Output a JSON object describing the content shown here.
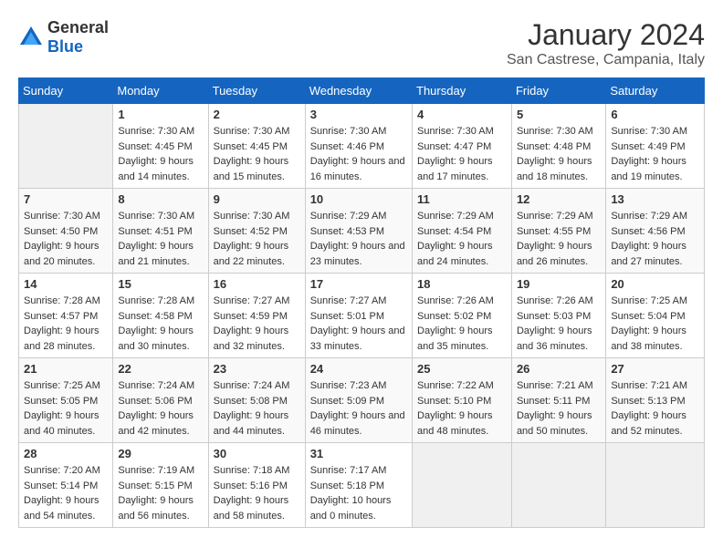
{
  "logo": {
    "general": "General",
    "blue": "Blue"
  },
  "header": {
    "title": "January 2024",
    "subtitle": "San Castrese, Campania, Italy"
  },
  "columns": [
    "Sunday",
    "Monday",
    "Tuesday",
    "Wednesday",
    "Thursday",
    "Friday",
    "Saturday"
  ],
  "weeks": [
    [
      {
        "day": "",
        "sunrise": "",
        "sunset": "",
        "daylight": ""
      },
      {
        "day": "1",
        "sunrise": "Sunrise: 7:30 AM",
        "sunset": "Sunset: 4:45 PM",
        "daylight": "Daylight: 9 hours and 14 minutes."
      },
      {
        "day": "2",
        "sunrise": "Sunrise: 7:30 AM",
        "sunset": "Sunset: 4:45 PM",
        "daylight": "Daylight: 9 hours and 15 minutes."
      },
      {
        "day": "3",
        "sunrise": "Sunrise: 7:30 AM",
        "sunset": "Sunset: 4:46 PM",
        "daylight": "Daylight: 9 hours and 16 minutes."
      },
      {
        "day": "4",
        "sunrise": "Sunrise: 7:30 AM",
        "sunset": "Sunset: 4:47 PM",
        "daylight": "Daylight: 9 hours and 17 minutes."
      },
      {
        "day": "5",
        "sunrise": "Sunrise: 7:30 AM",
        "sunset": "Sunset: 4:48 PM",
        "daylight": "Daylight: 9 hours and 18 minutes."
      },
      {
        "day": "6",
        "sunrise": "Sunrise: 7:30 AM",
        "sunset": "Sunset: 4:49 PM",
        "daylight": "Daylight: 9 hours and 19 minutes."
      }
    ],
    [
      {
        "day": "7",
        "sunrise": "Sunrise: 7:30 AM",
        "sunset": "Sunset: 4:50 PM",
        "daylight": "Daylight: 9 hours and 20 minutes."
      },
      {
        "day": "8",
        "sunrise": "Sunrise: 7:30 AM",
        "sunset": "Sunset: 4:51 PM",
        "daylight": "Daylight: 9 hours and 21 minutes."
      },
      {
        "day": "9",
        "sunrise": "Sunrise: 7:30 AM",
        "sunset": "Sunset: 4:52 PM",
        "daylight": "Daylight: 9 hours and 22 minutes."
      },
      {
        "day": "10",
        "sunrise": "Sunrise: 7:29 AM",
        "sunset": "Sunset: 4:53 PM",
        "daylight": "Daylight: 9 hours and 23 minutes."
      },
      {
        "day": "11",
        "sunrise": "Sunrise: 7:29 AM",
        "sunset": "Sunset: 4:54 PM",
        "daylight": "Daylight: 9 hours and 24 minutes."
      },
      {
        "day": "12",
        "sunrise": "Sunrise: 7:29 AM",
        "sunset": "Sunset: 4:55 PM",
        "daylight": "Daylight: 9 hours and 26 minutes."
      },
      {
        "day": "13",
        "sunrise": "Sunrise: 7:29 AM",
        "sunset": "Sunset: 4:56 PM",
        "daylight": "Daylight: 9 hours and 27 minutes."
      }
    ],
    [
      {
        "day": "14",
        "sunrise": "Sunrise: 7:28 AM",
        "sunset": "Sunset: 4:57 PM",
        "daylight": "Daylight: 9 hours and 28 minutes."
      },
      {
        "day": "15",
        "sunrise": "Sunrise: 7:28 AM",
        "sunset": "Sunset: 4:58 PM",
        "daylight": "Daylight: 9 hours and 30 minutes."
      },
      {
        "day": "16",
        "sunrise": "Sunrise: 7:27 AM",
        "sunset": "Sunset: 4:59 PM",
        "daylight": "Daylight: 9 hours and 32 minutes."
      },
      {
        "day": "17",
        "sunrise": "Sunrise: 7:27 AM",
        "sunset": "Sunset: 5:01 PM",
        "daylight": "Daylight: 9 hours and 33 minutes."
      },
      {
        "day": "18",
        "sunrise": "Sunrise: 7:26 AM",
        "sunset": "Sunset: 5:02 PM",
        "daylight": "Daylight: 9 hours and 35 minutes."
      },
      {
        "day": "19",
        "sunrise": "Sunrise: 7:26 AM",
        "sunset": "Sunset: 5:03 PM",
        "daylight": "Daylight: 9 hours and 36 minutes."
      },
      {
        "day": "20",
        "sunrise": "Sunrise: 7:25 AM",
        "sunset": "Sunset: 5:04 PM",
        "daylight": "Daylight: 9 hours and 38 minutes."
      }
    ],
    [
      {
        "day": "21",
        "sunrise": "Sunrise: 7:25 AM",
        "sunset": "Sunset: 5:05 PM",
        "daylight": "Daylight: 9 hours and 40 minutes."
      },
      {
        "day": "22",
        "sunrise": "Sunrise: 7:24 AM",
        "sunset": "Sunset: 5:06 PM",
        "daylight": "Daylight: 9 hours and 42 minutes."
      },
      {
        "day": "23",
        "sunrise": "Sunrise: 7:24 AM",
        "sunset": "Sunset: 5:08 PM",
        "daylight": "Daylight: 9 hours and 44 minutes."
      },
      {
        "day": "24",
        "sunrise": "Sunrise: 7:23 AM",
        "sunset": "Sunset: 5:09 PM",
        "daylight": "Daylight: 9 hours and 46 minutes."
      },
      {
        "day": "25",
        "sunrise": "Sunrise: 7:22 AM",
        "sunset": "Sunset: 5:10 PM",
        "daylight": "Daylight: 9 hours and 48 minutes."
      },
      {
        "day": "26",
        "sunrise": "Sunrise: 7:21 AM",
        "sunset": "Sunset: 5:11 PM",
        "daylight": "Daylight: 9 hours and 50 minutes."
      },
      {
        "day": "27",
        "sunrise": "Sunrise: 7:21 AM",
        "sunset": "Sunset: 5:13 PM",
        "daylight": "Daylight: 9 hours and 52 minutes."
      }
    ],
    [
      {
        "day": "28",
        "sunrise": "Sunrise: 7:20 AM",
        "sunset": "Sunset: 5:14 PM",
        "daylight": "Daylight: 9 hours and 54 minutes."
      },
      {
        "day": "29",
        "sunrise": "Sunrise: 7:19 AM",
        "sunset": "Sunset: 5:15 PM",
        "daylight": "Daylight: 9 hours and 56 minutes."
      },
      {
        "day": "30",
        "sunrise": "Sunrise: 7:18 AM",
        "sunset": "Sunset: 5:16 PM",
        "daylight": "Daylight: 9 hours and 58 minutes."
      },
      {
        "day": "31",
        "sunrise": "Sunrise: 7:17 AM",
        "sunset": "Sunset: 5:18 PM",
        "daylight": "Daylight: 10 hours and 0 minutes."
      },
      {
        "day": "",
        "sunrise": "",
        "sunset": "",
        "daylight": ""
      },
      {
        "day": "",
        "sunrise": "",
        "sunset": "",
        "daylight": ""
      },
      {
        "day": "",
        "sunrise": "",
        "sunset": "",
        "daylight": ""
      }
    ]
  ]
}
